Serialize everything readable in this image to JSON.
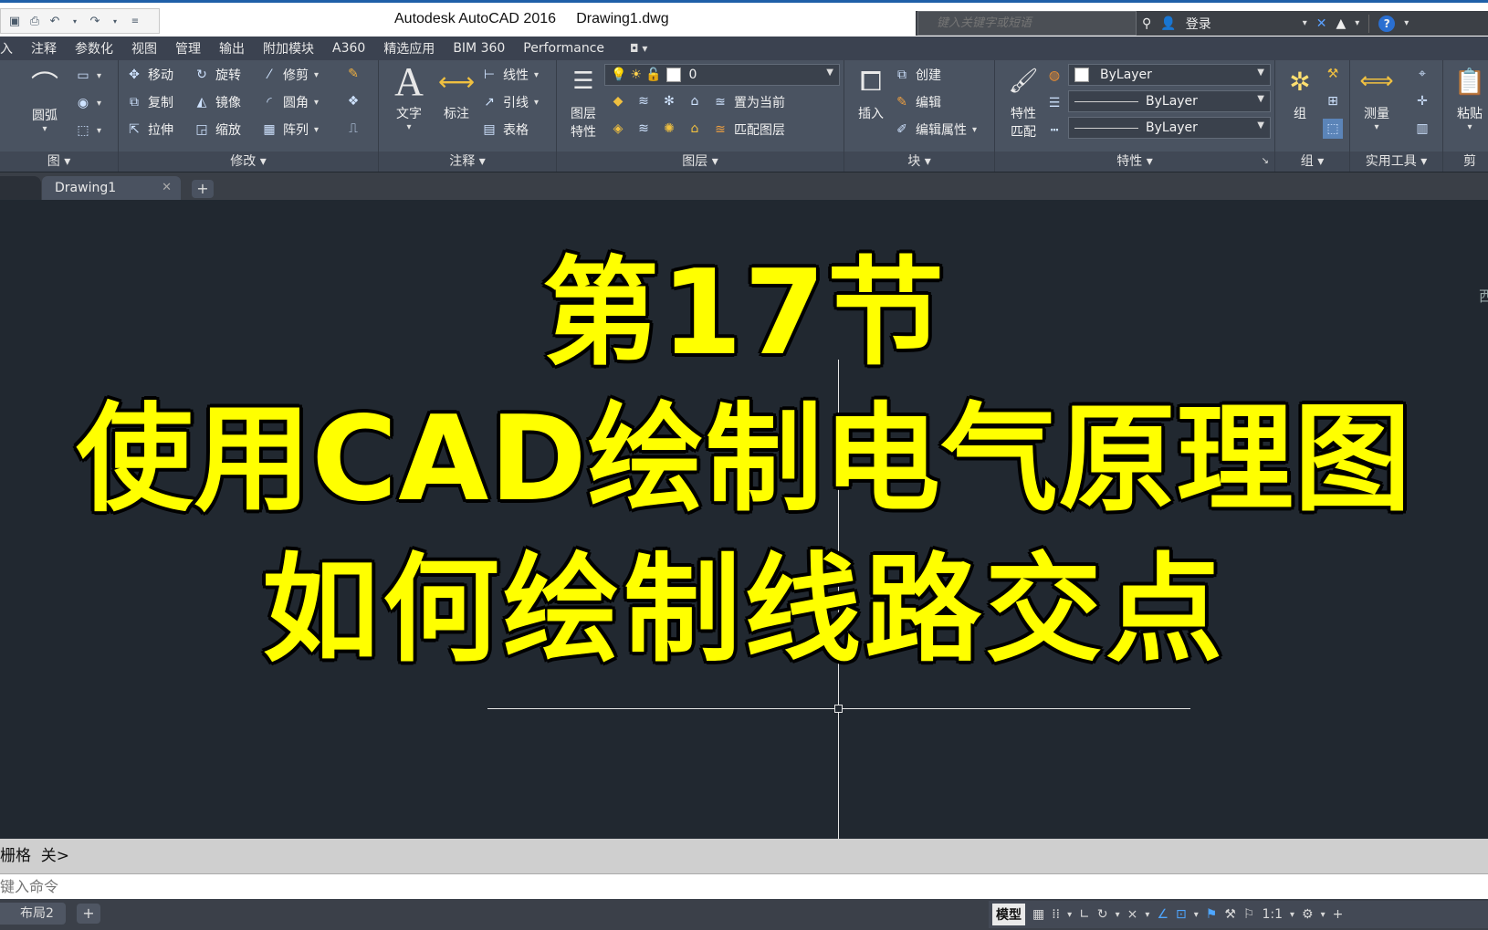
{
  "title_bar": {
    "title": "Autodesk AutoCAD 2016     Drawing1.dwg",
    "search_placeholder": "键入关键字或短语",
    "login_label": "登录"
  },
  "menu": {
    "items": [
      "插入",
      "注释",
      "参数化",
      "视图",
      "管理",
      "输出",
      "附加模块",
      "A360",
      "精选应用",
      "BIM 360",
      "Performance"
    ]
  },
  "ribbon": {
    "draw": {
      "arc_label": "圆弧",
      "panel_title": "图"
    },
    "modify": {
      "move": "移动",
      "rotate": "旋转",
      "trim": "修剪",
      "copy": "复制",
      "mirror": "镜像",
      "fillet": "圆角",
      "stretch": "拉伸",
      "scale": "缩放",
      "array": "阵列",
      "panel_title": "修改"
    },
    "annotation": {
      "text": "文字",
      "dimension": "标注",
      "linear": "线性",
      "leader": "引线",
      "table": "表格",
      "panel_title": "注释"
    },
    "layers": {
      "layer_props_line1": "图层",
      "layer_props_line2": "特性",
      "current_layer": "0",
      "set_current": "置为当前",
      "match_layer": "匹配图层",
      "panel_title": "图层"
    },
    "block": {
      "insert": "插入",
      "create": "创建",
      "edit": "编辑",
      "edit_attributes": "编辑属性",
      "panel_title": "块"
    },
    "properties": {
      "match_line1": "特性",
      "match_line2": "匹配",
      "color": "ByLayer",
      "linetype": "ByLayer",
      "lineweight": "ByLayer",
      "panel_title": "特性"
    },
    "groups": {
      "group": "组",
      "panel_title": "组"
    },
    "utilities": {
      "measure": "测量",
      "panel_title": "实用工具"
    },
    "clipboard": {
      "paste": "粘贴",
      "panel_title": "剪贴"
    }
  },
  "doc_tabs": {
    "active_tab": "Drawing1"
  },
  "canvas": {
    "line1": "第17节",
    "line2": "使用CAD绘制电气原理图",
    "line3": "如何绘制线路交点",
    "viewcube_partial": "西"
  },
  "command": {
    "history": "栅格  关>",
    "placeholder": "键入命令"
  },
  "status": {
    "layout_tab": "布局2",
    "model": "模型",
    "scale": "1:1"
  },
  "colors": {
    "title_text": "#ffff00",
    "canvas_bg": "#212830",
    "ribbon_bg": "#4a5361"
  }
}
